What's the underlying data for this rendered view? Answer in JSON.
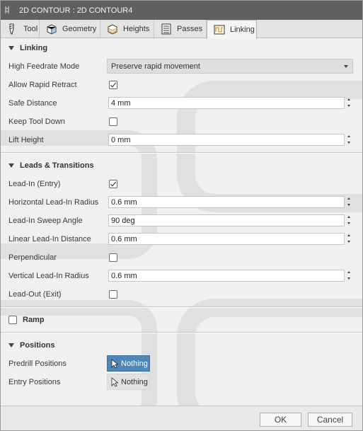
{
  "window": {
    "title": "2D CONTOUR : 2D CONTOUR4"
  },
  "tabs": [
    {
      "label": "Tool",
      "icon": "tool-icon"
    },
    {
      "label": "Geometry",
      "icon": "geometry-icon"
    },
    {
      "label": "Heights",
      "icon": "heights-icon"
    },
    {
      "label": "Passes",
      "icon": "passes-icon"
    },
    {
      "label": "Linking",
      "icon": "linking-icon",
      "active": true
    }
  ],
  "linking": {
    "header": "Linking",
    "high_feedrate_label": "High Feedrate Mode",
    "high_feedrate_value": "Preserve rapid movement",
    "allow_rapid_retract_label": "Allow Rapid Retract",
    "allow_rapid_retract_checked": true,
    "safe_distance_label": "Safe Distance",
    "safe_distance_value": "4 mm",
    "keep_tool_down_label": "Keep Tool Down",
    "keep_tool_down_checked": false,
    "lift_height_label": "Lift Height",
    "lift_height_value": "0 mm"
  },
  "leads": {
    "header": "Leads & Transitions",
    "lead_in_label": "Lead-In (Entry)",
    "lead_in_checked": true,
    "horizontal_radius_label": "Horizontal Lead-In Radius",
    "horizontal_radius_value": "0.6 mm",
    "sweep_angle_label": "Lead-In Sweep Angle",
    "sweep_angle_value": "90 deg",
    "linear_distance_label": "Linear Lead-In Distance",
    "linear_distance_value": "0.6 mm",
    "perpendicular_label": "Perpendicular",
    "perpendicular_checked": false,
    "vertical_radius_label": "Vertical Lead-In Radius",
    "vertical_radius_value": "0.6 mm",
    "lead_out_label": "Lead-Out (Exit)",
    "lead_out_checked": false
  },
  "ramp": {
    "header": "Ramp",
    "checked": false
  },
  "positions": {
    "header": "Positions",
    "predrill_label": "Predrill Positions",
    "predrill_button": "Nothing",
    "entry_label": "Entry Positions",
    "entry_button": "Nothing"
  },
  "footer": {
    "ok_label": "OK",
    "cancel_label": "Cancel"
  },
  "colors": {
    "titlebar": "#606060",
    "selection_active": "#4f87b8",
    "panel_background": "#f0f0f0"
  }
}
